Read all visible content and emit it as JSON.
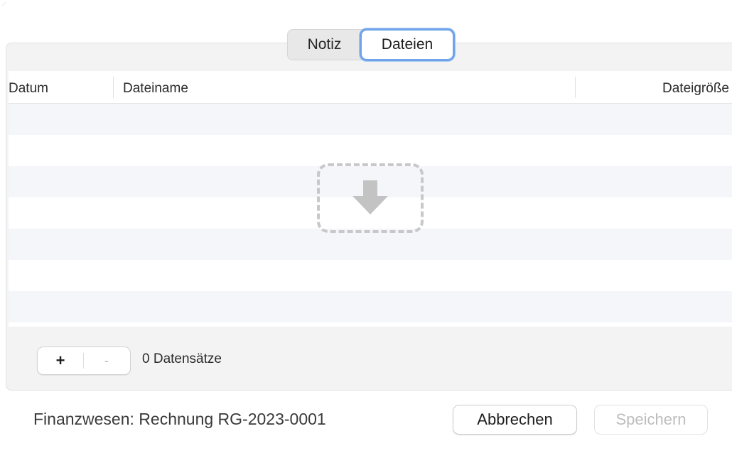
{
  "tabs": {
    "notiz": "Notiz",
    "dateien": "Dateien",
    "selected": "Dateien"
  },
  "table": {
    "columns": {
      "datum": "Datum",
      "dateiname": "Dateiname",
      "dateigroesse": "Dateigröße"
    },
    "rows": []
  },
  "dropzone": {
    "icon": "download-arrow-icon"
  },
  "stepper": {
    "plus": "+",
    "minus": "-"
  },
  "record_count": "0 Datensätze",
  "footer": {
    "label": "Finanzwesen: Rechnung RG-2023-0001",
    "cancel": "Abbrechen",
    "save": "Speichern"
  },
  "colors": {
    "accent": "#6fa3ea",
    "stripe": "#f4f6f9",
    "panel": "#f3f3f3",
    "disabled_text": "#bdbdbd"
  }
}
